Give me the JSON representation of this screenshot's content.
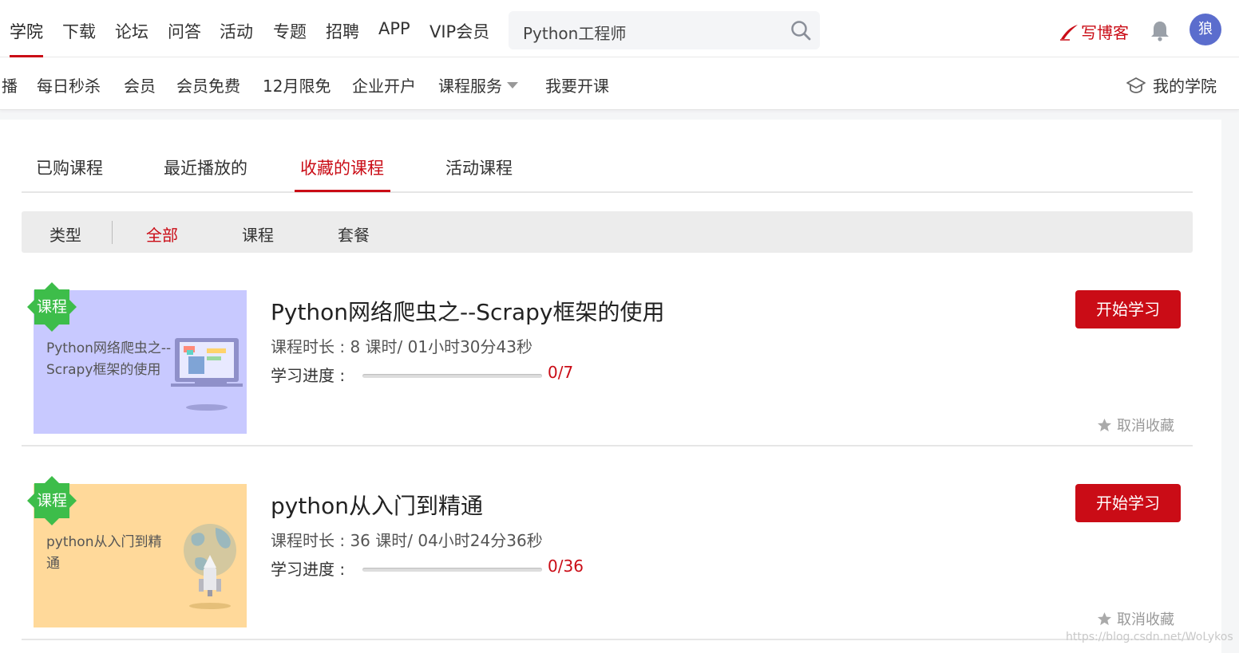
{
  "top_nav": {
    "items": [
      "学院",
      "下载",
      "论坛",
      "问答",
      "活动",
      "专题",
      "招聘",
      "APP",
      "VIP会员"
    ],
    "active_index": 0,
    "search_value": "Python工程师",
    "write_blog": "写博客",
    "avatar_text": "狼"
  },
  "sub_nav": {
    "items": [
      "播",
      "每日秒杀",
      "会员",
      "会员免费",
      "12月限免",
      "企业开户",
      "课程服务",
      "我要开课"
    ],
    "my_academy": "我的学院"
  },
  "tabs": {
    "items": [
      "已购课程",
      "最近播放的",
      "收藏的课程",
      "活动课程"
    ],
    "active_index": 2
  },
  "filter": {
    "label": "类型",
    "options": [
      "全部",
      "课程",
      "套餐"
    ],
    "active_index": 0
  },
  "courses": [
    {
      "badge": "课程",
      "thumb_text": "Python网络爬虫之--Scrapy框架的使用",
      "thumb_color": "#c8c9ff",
      "title": "Python网络爬虫之--Scrapy框架的使用",
      "duration": "课程时长 : 8 课时/ 01小时30分43秒",
      "progress_label": "学习进度 :",
      "progress_count": "0/7",
      "progress_fraction": 0,
      "start_label": "开始学习",
      "unfav_label": "取消收藏"
    },
    {
      "badge": "课程",
      "thumb_text": "python从入门到精通",
      "thumb_color": "#ffd99a",
      "title": "python从入门到精通",
      "duration": "课程时长 : 36 课时/ 04小时24分36秒",
      "progress_label": "学习进度 :",
      "progress_count": "0/36",
      "progress_fraction": 0,
      "start_label": "开始学习",
      "unfav_label": "取消收藏"
    }
  ],
  "icons": {
    "search": "search-icon",
    "bell": "bell-icon",
    "write": "pen-icon",
    "academy": "graduation-cap-icon",
    "star": "star-icon",
    "caret": "caret-down-icon"
  },
  "colors": {
    "accent": "#ca0c16",
    "badge_green": "#3dbd4a",
    "avatar_bg": "#5b6dcd"
  },
  "watermark": "https://blog.csdn.net/WoLykos"
}
